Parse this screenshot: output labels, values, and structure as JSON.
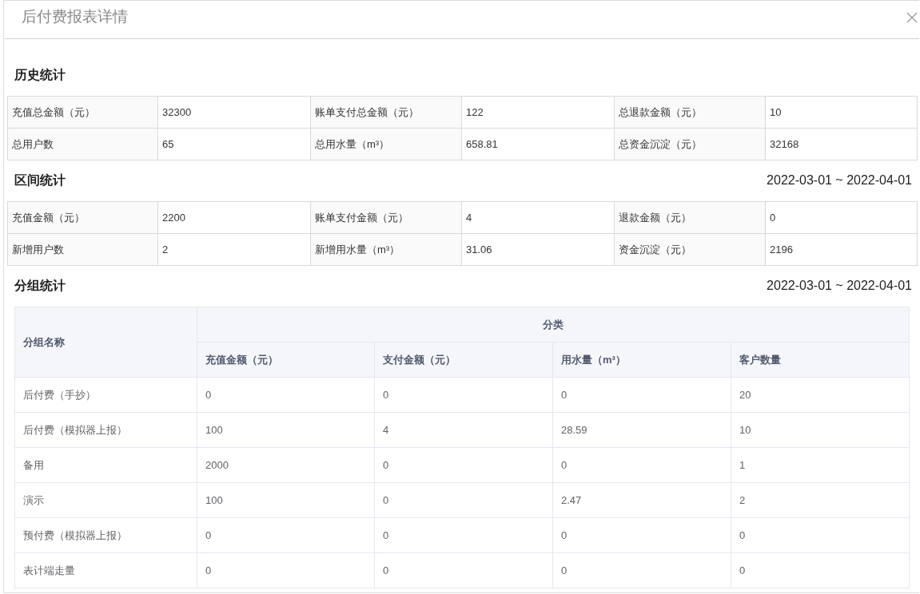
{
  "window": {
    "title": "后付费报表详情"
  },
  "history": {
    "title": "历史统计",
    "rows": [
      [
        {
          "label": "充值总金额（元）",
          "value": "32300"
        },
        {
          "label": "账单支付总金额（元）",
          "value": "122"
        },
        {
          "label": "总退款金额（元）",
          "value": "10"
        }
      ],
      [
        {
          "label": "总用户数",
          "value": "65"
        },
        {
          "label": "总用水量（m³）",
          "value": "658.81"
        },
        {
          "label": "总资金沉淀（元）",
          "value": "32168"
        }
      ]
    ]
  },
  "interval": {
    "title": "区间统计",
    "date_range": "2022-03-01 ~ 2022-04-01",
    "rows": [
      [
        {
          "label": "充值金额（元）",
          "value": "2200"
        },
        {
          "label": "账单支付金额（元）",
          "value": "4"
        },
        {
          "label": "退款金额（元）",
          "value": "0"
        }
      ],
      [
        {
          "label": "新增用户数",
          "value": "2"
        },
        {
          "label": "新增用水量（m³）",
          "value": "31.06"
        },
        {
          "label": "资金沉淀（元）",
          "value": "2196"
        }
      ]
    ]
  },
  "group": {
    "title": "分组统计",
    "date_range": "2022-03-01 ~ 2022-04-01",
    "category_header": "分类",
    "columns": [
      "分组名称",
      "充值金额（元）",
      "支付金额（元）",
      "用水量（m³）",
      "客户数量"
    ],
    "rows": [
      [
        "后付费（手抄）",
        "0",
        "0",
        "0",
        "20"
      ],
      [
        "后付费（模拟器上报）",
        "100",
        "4",
        "28.59",
        "10"
      ],
      [
        "备用",
        "2000",
        "0",
        "0",
        "1"
      ],
      [
        "演示",
        "100",
        "0",
        "2.47",
        "2"
      ],
      [
        "预付费（模拟器上报）",
        "0",
        "0",
        "0",
        "0"
      ],
      [
        "表计端走量",
        "0",
        "0",
        "0",
        "0"
      ]
    ]
  }
}
